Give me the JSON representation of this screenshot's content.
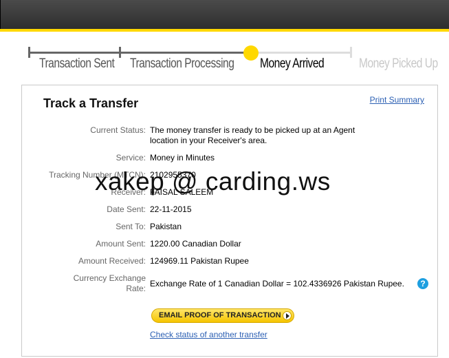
{
  "progress": {
    "steps": [
      {
        "label": "Transaction Sent",
        "state": "done"
      },
      {
        "label": "Transaction Processing",
        "state": "done"
      },
      {
        "label": "Money Arrived",
        "state": "current"
      },
      {
        "label": "Money Picked Up",
        "state": "todo"
      }
    ]
  },
  "card": {
    "title": "Track a Transfer",
    "print_link": "Print Summary",
    "fields": [
      {
        "label": "Current Status:",
        "value": "The money transfer is ready to be picked up at an Agent location in your Receiver's area."
      },
      {
        "label": "Service:",
        "value": "Money in Minutes"
      },
      {
        "label": "Tracking Number (MTCN):",
        "value": "2102955370"
      },
      {
        "label": "Receiver:",
        "value": "FAISAL SALEEM"
      },
      {
        "label": "Date Sent:",
        "value": "22-11-2015"
      },
      {
        "label": "Sent To:",
        "value": "Pakistan"
      },
      {
        "label": "Amount Sent:",
        "value": "1220.00 Canadian Dollar"
      },
      {
        "label": "Amount Received:",
        "value": "124969.11 Pakistan Rupee"
      },
      {
        "label": "Currency Exchange Rate:",
        "value": "Exchange Rate of 1 Canadian Dollar = 102.4336926 Pakistan Rupee."
      }
    ],
    "help_icon": "?",
    "email_button": "EMAIL PROOF OF TRANSACTION",
    "check_link": "Check status of another transfer"
  },
  "watermark": "xakep @ carding.ws",
  "colors": {
    "accent_yellow": "#ffd800",
    "link_blue": "#2b5fb3",
    "help_blue": "#1e9fe0",
    "header_dark": "#3a3a3a"
  }
}
